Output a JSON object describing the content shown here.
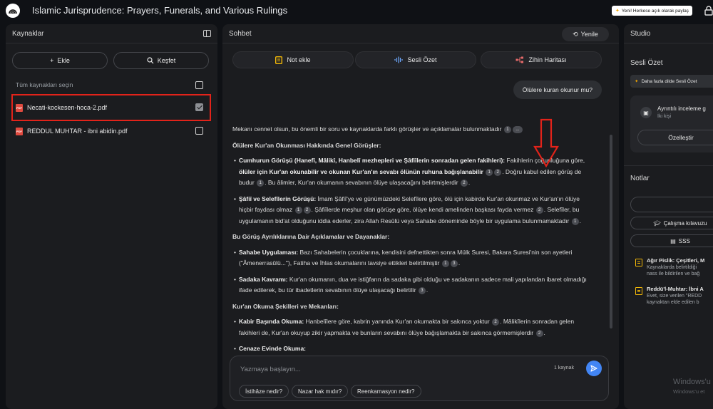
{
  "app": {
    "title": "Islamic Jurisprudence: Prayers, Funerals, and Various Rulings",
    "share_label": "Yeni! Herkese açık olarak paylaş"
  },
  "sources_panel": {
    "title": "Kaynaklar",
    "add_label": "Ekle",
    "discover_label": "Keşfet",
    "select_all_label": "Tüm kaynakları seçin",
    "sources": [
      {
        "name": "Necati-kockesen-hoca-2.pdf",
        "checked": true
      },
      {
        "name": "REDDUL MUHTAR - ibni abidin.pdf",
        "checked": false
      }
    ]
  },
  "chat_panel": {
    "title": "Sohbet",
    "refresh_label": "Yenile",
    "tools": {
      "add_note": "Not ekle",
      "audio_summary": "Sesli Özet",
      "mind_map": "Zihin Haritası"
    },
    "user_message": "Ölülere kuran okunur mu?",
    "answer": {
      "intro": "Mekanı cennet olsun, bu önemli bir soru ve kaynaklarda farklı görüşler ve açıklamalar bulunmaktadır",
      "h1": "Ölülere Kur'an Okunması Hakkında Genel Görüşler:",
      "b1_bold": "Cumhurun Görüşü (Hanefî, Mâlikî, Hanbelî mezhepleri ve Şâfiîlerin sonradan gelen fakihleri):",
      "b1_text1": " Fakihlerin çoğunluğuna göre, ",
      "b1_bold2": "ölüler için Kur'an okunabilir ve okunan Kur'an'ın sevabı ölünün ruhuna bağışlanabilir",
      "b1_text2": ". Doğru kabul edilen görüş de budur",
      "b1_text3": ". Bu âlimler, Kur'an okumanın sevabının ölüye ulaşacağını belirtmişlerdir",
      "b2_bold": "Şâfiî ve Selefîlerin Görüşü:",
      "b2_text1": " İmam Şâfiî'ye ve günümüzdeki Selefîlere göre, ölü için kabirde Kur'an okunmaz ve Kur'an'ın ölüye hiçbir faydası olmaz",
      "b2_text2": ". Şâfiîlerde meşhur olan görüşe göre, ölüye kendi amelinden başkası fayda vermez",
      "b2_text3": ". Selefîler, bu uygulamanın bid'at olduğunu iddia ederler, zira Allah Resûlü veya Sahabe döneminde böyle bir uygulama bulunmamaktadır",
      "h2": "Bu Görüş Ayrılıklarına Dair Açıklamalar ve Dayanaklar:",
      "b3_bold": "Sahabe Uygulaması:",
      "b3_text1": " Bazı Sahabelerin çocuklarına, kendisini defnettikten sonra Mülk Suresi, Bakara Suresi'nin son ayetleri (\"Âmenerrasûlü...\"), Fatiha ve İhlas okumalarını tavsiye ettikleri belirtilmiştir",
      "b4_bold": "Sadaka Kavramı:",
      "b4_text1": " Kur'an okumanın, dua ve istiğfarın da sadaka gibi olduğu ve sadakanın sadece mali yapılandan ibaret olmadığı ifade edilerek, bu tür ibadetlerin sevabının ölüye ulaşacağı belirtilir",
      "h3": "Kur'an Okuma Şekilleri ve Mekanları:",
      "b5_bold": "Kabir Başında Okuma:",
      "b5_text1": " Hanbelîlere göre, kabrin yanında Kur'an okumakta bir sakınca yoktur",
      "b5_text2": ". Mâlikîlerin sonradan gelen fakihleri de, Kur'an okuyup zikir yapmakta ve bunların sevabını ölüye bağışlamakta bir sakınca görmemişlerdir",
      "b6_bold": "Cenaze Evinde Okuma:",
      "refs": {
        "r1": "1",
        "r2": "2",
        "r3": "3",
        "more": "..."
      }
    },
    "input": {
      "placeholder": "Yazmaya başlayın...",
      "source_count": "1 kaynak"
    },
    "suggestions": [
      "İstihâze nedir?",
      "Nazar hak mıdır?",
      "Reenkarnasyon nedir?"
    ]
  },
  "studio_panel": {
    "title": "Studio",
    "audio_title": "Sesli Özet",
    "banner": "Daha fazla dilde Sesli Özet",
    "card_title": "Ayrıntılı inceleme g",
    "card_sub": "İki kişi",
    "customize_label": "Özelleştir",
    "notes_title": "Notlar",
    "add_note_label": "+",
    "chip_study_guide": "Çalışma kılavuzu",
    "chip_faq": "SSS",
    "notes": [
      {
        "title": "Ağır Pislik: Çeşitleri, M",
        "body1": "Kaynaklarda belirtildiği",
        "body2": "nass ile bildirilen ve bağ"
      },
      {
        "title": "Reddü'l-Muhtar: İbni A",
        "body1": "Evet, size verilen \"REDD",
        "body2": "kaynaktan elde edilen b"
      }
    ]
  },
  "watermark": {
    "title": "Windows'u",
    "subtitle": "Windows'u et"
  },
  "colors": {
    "background": "#0f1115",
    "panel": "#1b1c1f",
    "highlight": "#e2231a",
    "send": "#4285f4",
    "note_icon": "#f2b707"
  }
}
